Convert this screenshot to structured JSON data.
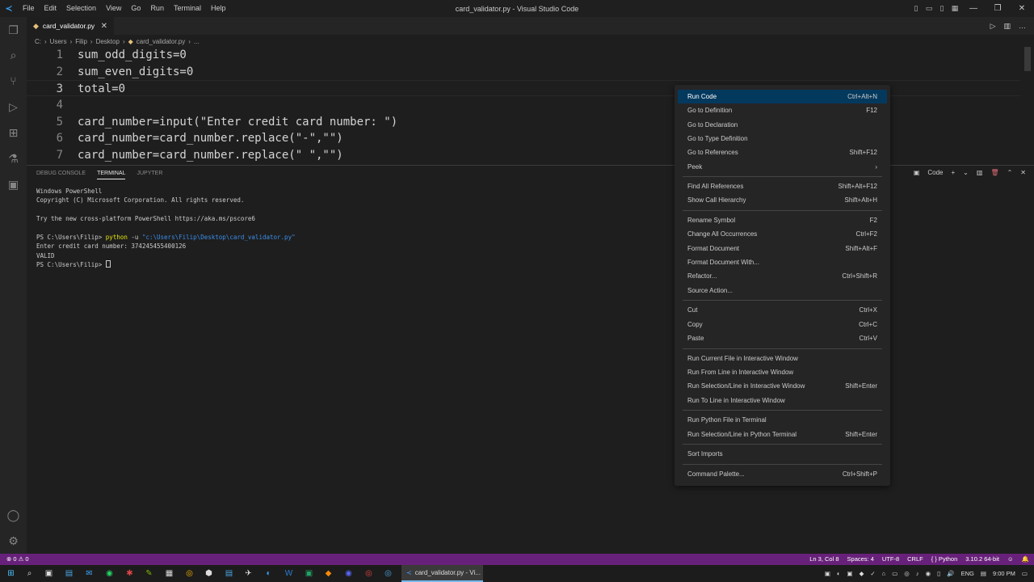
{
  "titlebar": {
    "menu": [
      "File",
      "Edit",
      "Selection",
      "View",
      "Go",
      "Run",
      "Terminal",
      "Help"
    ],
    "title": "card_validator.py - Visual Studio Code"
  },
  "tab": {
    "label": "card_validator.py"
  },
  "breadcrumb": [
    "C:",
    "Users",
    "Filip",
    "Desktop",
    "card_validator.py",
    "..."
  ],
  "editor": {
    "lines": [
      {
        "n": "1",
        "code": "sum_odd_digits=0"
      },
      {
        "n": "2",
        "code": "sum_even_digits=0"
      },
      {
        "n": "3",
        "code": "total=0"
      },
      {
        "n": "4",
        "code": ""
      },
      {
        "n": "5",
        "code": "card_number=input(\"Enter credit card number: \")"
      },
      {
        "n": "6",
        "code": "card_number=card_number.replace(\"-\",\"\")"
      },
      {
        "n": "7",
        "code": "card_number=card_number.replace(\" \",\"\")"
      }
    ]
  },
  "panel": {
    "tabs": [
      "DEBUG CONSOLE",
      "TERMINAL",
      "JUPYTER"
    ],
    "code_label": "Code",
    "terminal": {
      "l1": "Windows PowerShell",
      "l2": "Copyright (C) Microsoft Corporation. All rights reserved.",
      "l3": "Try the new cross-platform PowerShell https://aka.ms/pscore6",
      "prompt": "PS C:\\Users\\Filip> ",
      "cmd": "python",
      "flag": " -u ",
      "path": "\"c:\\Users\\Filip\\Desktop\\card_validator.py\"",
      "l5": "Enter credit card number: 374245455400126",
      "l6": "VALID",
      "l7": "PS C:\\Users\\Filip> "
    }
  },
  "context_menu": {
    "items": [
      {
        "label": "Run Code",
        "key": "Ctrl+Alt+N"
      },
      {
        "label": "Go to Definition",
        "key": "F12"
      },
      {
        "label": "Go to Declaration",
        "key": ""
      },
      {
        "label": "Go to Type Definition",
        "key": ""
      },
      {
        "label": "Go to References",
        "key": "Shift+F12"
      },
      {
        "label": "Peek",
        "key": "›"
      },
      {
        "label": "Find All References",
        "key": "Shift+Alt+F12"
      },
      {
        "label": "Show Call Hierarchy",
        "key": "Shift+Alt+H"
      },
      {
        "label": "Rename Symbol",
        "key": "F2"
      },
      {
        "label": "Change All Occurrences",
        "key": "Ctrl+F2"
      },
      {
        "label": "Format Document",
        "key": "Shift+Alt+F"
      },
      {
        "label": "Format Document With...",
        "key": ""
      },
      {
        "label": "Refactor...",
        "key": "Ctrl+Shift+R"
      },
      {
        "label": "Source Action...",
        "key": ""
      },
      {
        "label": "Cut",
        "key": "Ctrl+X"
      },
      {
        "label": "Copy",
        "key": "Ctrl+C"
      },
      {
        "label": "Paste",
        "key": "Ctrl+V"
      },
      {
        "label": "Run Current File in Interactive Window",
        "key": ""
      },
      {
        "label": "Run From Line in Interactive Window",
        "key": ""
      },
      {
        "label": "Run Selection/Line in Interactive Window",
        "key": "Shift+Enter"
      },
      {
        "label": "Run To Line in Interactive Window",
        "key": ""
      },
      {
        "label": "Run Python File in Terminal",
        "key": ""
      },
      {
        "label": "Run Selection/Line in Python Terminal",
        "key": "Shift+Enter"
      },
      {
        "label": "Sort Imports",
        "key": ""
      },
      {
        "label": "Command Palette...",
        "key": "Ctrl+Shift+P"
      }
    ]
  },
  "statusbar": {
    "problems": "⊗ 0 ⚠ 0",
    "position": "Ln 3, Col 8",
    "spaces": "Spaces: 4",
    "encoding": "UTF-8",
    "eol": "CRLF",
    "language": "Python",
    "interpreter": "3.10.2 64-bit"
  },
  "taskbar": {
    "active_app": "card_validator.py - Vi...",
    "lang": "ENG",
    "time": "9:00 PM"
  },
  "colors": {
    "statusbar": "#68217a",
    "menu_highlight": "#04395e"
  }
}
